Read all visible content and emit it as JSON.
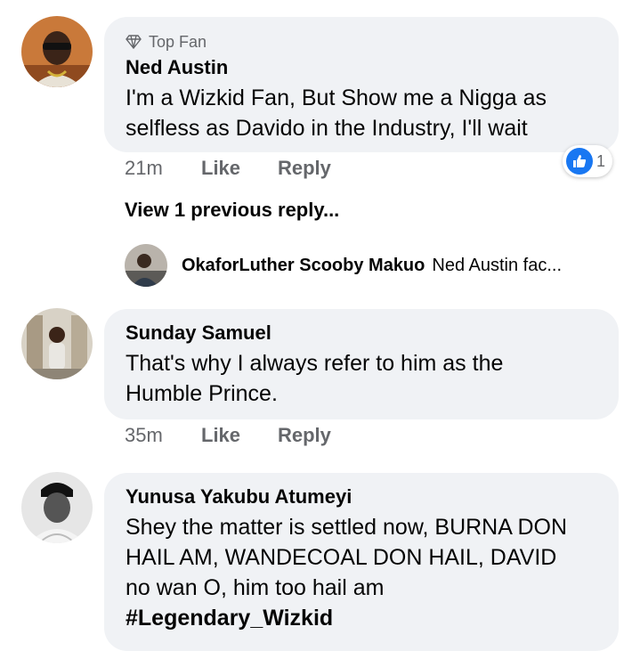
{
  "comments": [
    {
      "badge": "Top Fan",
      "author": "Ned Austin",
      "lines": [
        "I'm a Wizkid Fan, But Show me a Nigga as",
        "selfless as Davido in the Industry, I'll wait"
      ],
      "time": "21m",
      "like_label": "Like",
      "reply_label": "Reply",
      "reaction_count": "1",
      "view_previous": "View 1 previous reply...",
      "reply_preview": {
        "author": "OkaforLuther Scooby Makuo",
        "snippet": "Ned Austin fac..."
      }
    },
    {
      "author": "Sunday Samuel",
      "lines": [
        "That's why I always refer to him as the",
        "Humble Prince."
      ],
      "time": "35m",
      "like_label": "Like",
      "reply_label": "Reply"
    },
    {
      "author": "Yunusa Yakubu Atumeyi",
      "lines": [
        "Shey the matter is settled now, BURNA DON",
        "HAIL AM, WANDECOAL DON HAIL, DAVID",
        "no wan O, him too hail am"
      ],
      "hashtag": "#Legendary_Wizkid"
    }
  ],
  "colors": {
    "bubble": "#f0f2f5",
    "secondary_text": "#65676b",
    "like_blue": "#1877f2"
  }
}
